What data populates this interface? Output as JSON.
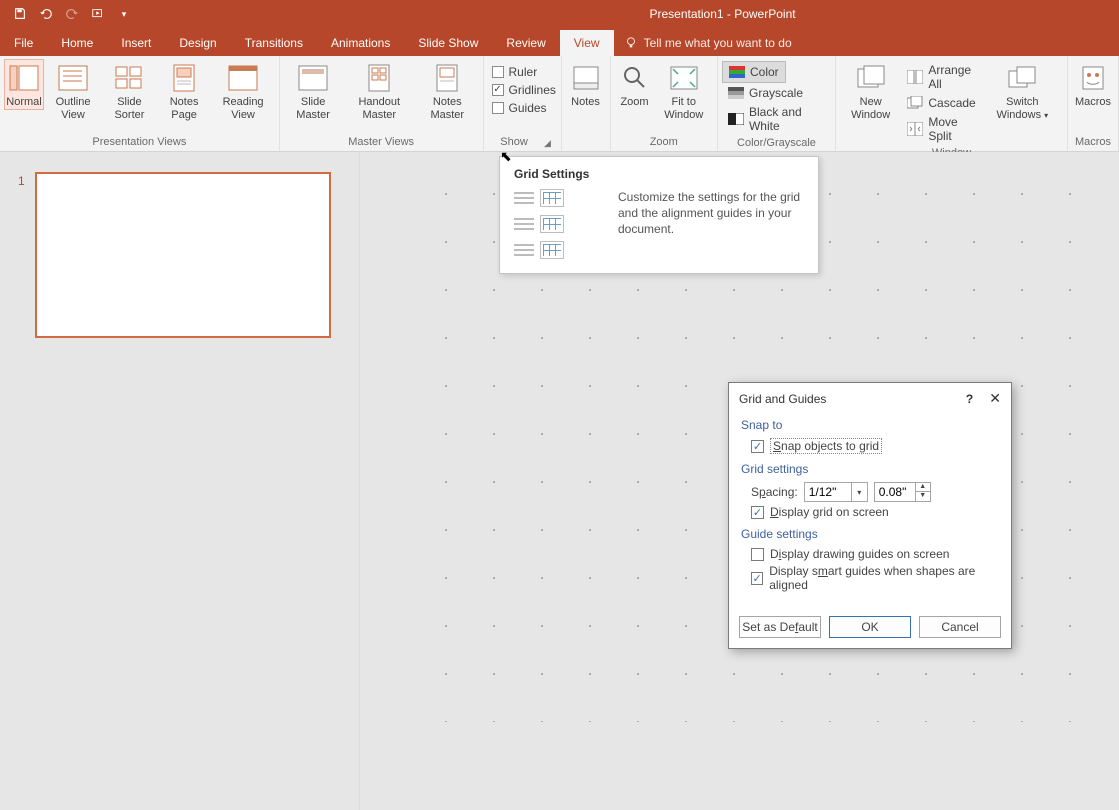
{
  "title": "Presentation1  -  PowerPoint",
  "tellme": "Tell me what you want to do",
  "tabs": {
    "file": "File",
    "home": "Home",
    "insert": "Insert",
    "design": "Design",
    "transitions": "Transitions",
    "animations": "Animations",
    "slideshow": "Slide Show",
    "review": "Review",
    "view": "View"
  },
  "ribbon": {
    "presentation_views": {
      "label": "Presentation Views",
      "normal": "Normal",
      "outline": "Outline View",
      "sorter": "Slide Sorter",
      "notes": "Notes Page",
      "reading": "Reading View"
    },
    "master_views": {
      "label": "Master Views",
      "slide": "Slide Master",
      "handout": "Handout Master",
      "notes": "Notes Master"
    },
    "show": {
      "label": "Show",
      "ruler": "Ruler",
      "gridlines": "Gridlines",
      "guides": "Guides",
      "ruler_checked": false,
      "gridlines_checked": true,
      "guides_checked": false
    },
    "notes": "Notes",
    "zoom": {
      "label": "Zoom",
      "zoom": "Zoom",
      "fit": "Fit to Window"
    },
    "color_grayscale": {
      "label": "Color/Grayscale",
      "color": "Color",
      "grayscale": "Grayscale",
      "bw": "Black and White"
    },
    "window": {
      "label": "Window",
      "new": "New Window",
      "arrange": "Arrange All",
      "cascade": "Cascade",
      "movesplit": "Move Split",
      "switch": "Switch Windows"
    },
    "macros": {
      "label": "Macros",
      "macros": "Macros"
    }
  },
  "thumb_number": "1",
  "tooltip": {
    "title": "Grid Settings",
    "text": "Customize the settings for the grid and the alignment guides in your document."
  },
  "dialog": {
    "title": "Grid and Guides",
    "snap_to": "Snap to",
    "snap_objects": "Snap objects to grid",
    "snap_objects_checked": true,
    "grid_settings": "Grid settings",
    "spacing_label": "Spacing:",
    "spacing_combo": "1/12\"",
    "spacing_value": "0.08\"",
    "display_grid": "Display grid on screen",
    "display_grid_checked": true,
    "guide_settings": "Guide settings",
    "display_drawing": "Display drawing guides on screen",
    "display_drawing_checked": false,
    "display_smart": "Display smart guides when shapes are aligned",
    "display_smart_checked": true,
    "set_default": "Set as Default",
    "ok": "OK",
    "cancel": "Cancel"
  }
}
